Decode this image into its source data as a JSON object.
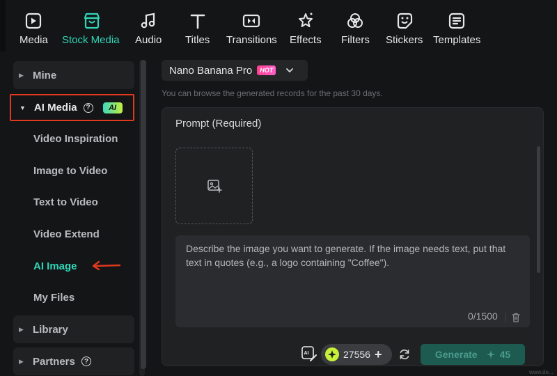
{
  "toolbar": {
    "items": [
      {
        "label": "Media",
        "icon": "media-icon"
      },
      {
        "label": "Stock Media",
        "icon": "stock-media-icon",
        "active": true
      },
      {
        "label": "Audio",
        "icon": "music-note-icon"
      },
      {
        "label": "Titles",
        "icon": "text-t-icon"
      },
      {
        "label": "Transitions",
        "icon": "transitions-icon"
      },
      {
        "label": "Effects",
        "icon": "effects-star-icon"
      },
      {
        "label": "Filters",
        "icon": "filters-icon"
      },
      {
        "label": "Stickers",
        "icon": "sticker-icon"
      },
      {
        "label": "Templates",
        "icon": "templates-icon"
      }
    ]
  },
  "sidebar": {
    "mine": "Mine",
    "ai_media": "AI Media",
    "ai_badge": "AI",
    "items": [
      "Video Inspiration",
      "Image to Video",
      "Text to Video",
      "Video Extend",
      "AI Image",
      "My Files"
    ],
    "active_item": "AI Image",
    "library": "Library",
    "partners": "Partners"
  },
  "main": {
    "model": "Nano Banana Pro",
    "hot_badge": "HOT",
    "hint": "You can browse the generated records for the past 30 days.",
    "prompt_title": "Prompt (Required)",
    "placeholder": "Describe the image you want to generate. If the image needs text, put that text in quotes (e.g., a logo containing \"Coffee\").",
    "counter": "0/1500",
    "credits": "27556",
    "generate_label": "Generate",
    "generate_cost": "45"
  },
  "colors": {
    "accent": "#2fd6b8",
    "highlight_box": "#e0391e",
    "background": "#141517",
    "panel": "#1f2123"
  },
  "watermark": "www.de..."
}
